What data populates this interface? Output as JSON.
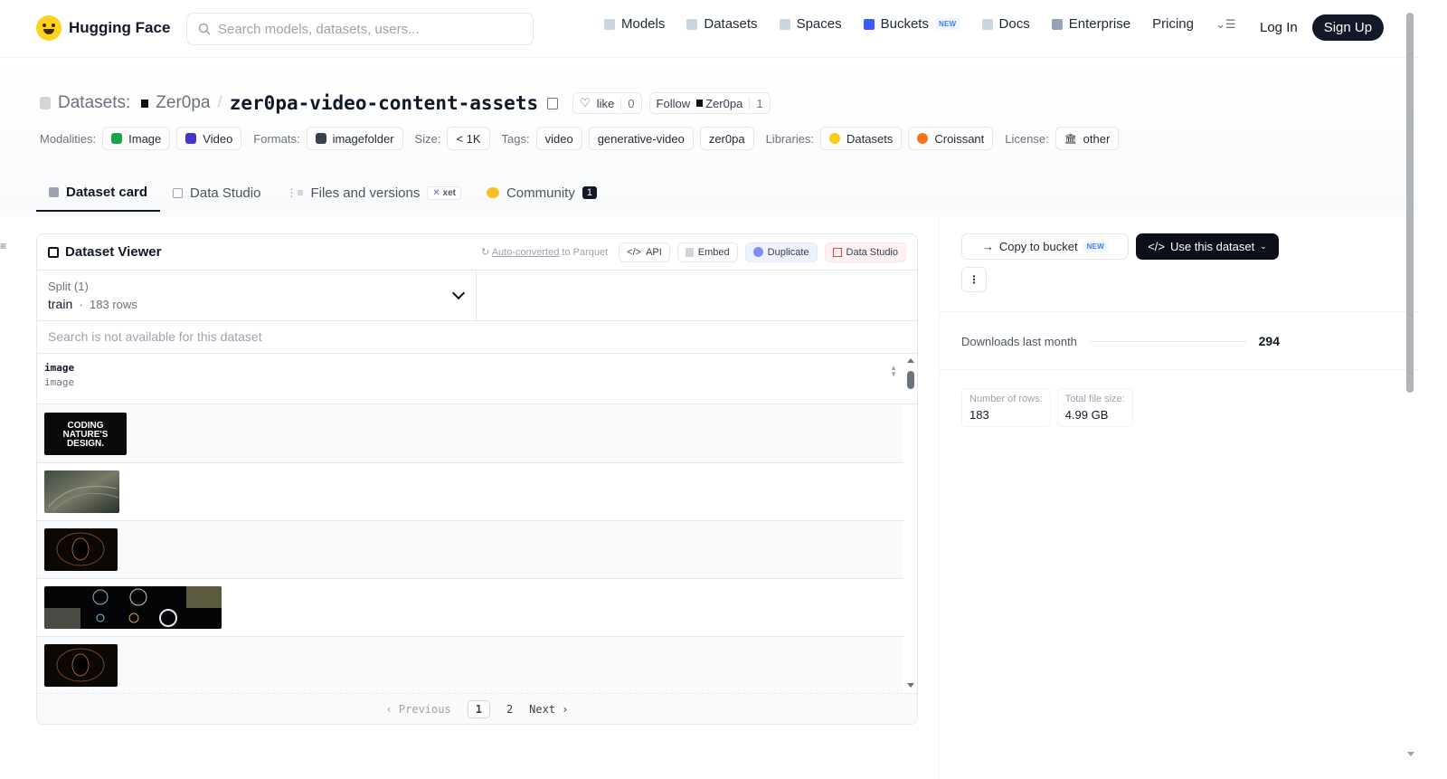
{
  "header": {
    "brand": "Hugging Face",
    "search_placeholder": "Search models, datasets, users...",
    "nav": [
      {
        "label": "Models",
        "icon": "cube-icon"
      },
      {
        "label": "Datasets",
        "icon": "database-icon"
      },
      {
        "label": "Spaces",
        "icon": "grid-icon"
      },
      {
        "label": "Buckets",
        "icon": "bucket-icon",
        "badge": "NEW"
      },
      {
        "label": "Docs",
        "icon": "book-icon"
      },
      {
        "label": "Enterprise",
        "icon": "enterprise-icon"
      },
      {
        "label": "Pricing"
      }
    ],
    "login": "Log In",
    "signup": "Sign Up"
  },
  "repo": {
    "type_label": "Datasets:",
    "owner": "Zer0pa",
    "separator": "/",
    "name": "zer0pa-video-content-assets",
    "like_label": "like",
    "like_count": "0",
    "follow_label": "Follow",
    "follow_owner": "Zer0pa",
    "follow_count": "1"
  },
  "tags": {
    "modalities_label": "Modalities:",
    "modalities": [
      "Image",
      "Video"
    ],
    "formats_label": "Formats:",
    "formats": [
      "imagefolder"
    ],
    "size_label": "Size:",
    "size": "< 1K",
    "tags_label": "Tags:",
    "tags": [
      "video",
      "generative-video",
      "zer0pa"
    ],
    "libraries_label": "Libraries:",
    "libraries": [
      "Datasets",
      "Croissant"
    ],
    "license_label": "License:",
    "license": "other"
  },
  "tabs": [
    {
      "label": "Dataset card",
      "active": true
    },
    {
      "label": "Data Studio"
    },
    {
      "label": "Files and versions",
      "badge": "xet"
    },
    {
      "label": "Community",
      "badge": "1"
    }
  ],
  "viewer": {
    "title": "Dataset Viewer",
    "auto_converted": "Auto-converted",
    "auto_suffix": "to Parquet",
    "api": "API",
    "embed": "Embed",
    "duplicate": "Duplicate",
    "data_studio": "Data Studio",
    "split_label": "Split (1)",
    "split_value": "train",
    "split_rows": "183 rows",
    "search_text": "Search is not available for this dataset",
    "column_name": "image",
    "column_type": "image",
    "thumbnail_text": "CODING NATURE'S DESIGN.",
    "pager": {
      "previous": "Previous",
      "pages": [
        "1",
        "2"
      ],
      "current": "1",
      "next": "Next"
    }
  },
  "sidebar": {
    "copy_to_bucket": "Copy to bucket",
    "copy_badge": "NEW",
    "use_dataset": "Use this dataset",
    "more": "⋮",
    "downloads_label": "Downloads last month",
    "downloads_value": "294",
    "rows_label": "Number of rows:",
    "rows_value": "183",
    "size_label": "Total file size:",
    "size_value": "4.99 GB"
  }
}
